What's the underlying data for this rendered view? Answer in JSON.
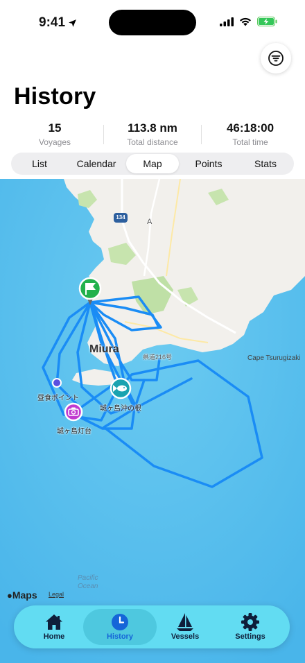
{
  "status_bar": {
    "time": "9:41"
  },
  "header": {
    "title": "History",
    "filter_icon": "filter-icon"
  },
  "stats": [
    {
      "value": "15",
      "label": "Voyages"
    },
    {
      "value": "113.8 nm",
      "label": "Total distance"
    },
    {
      "value": "46:18:00",
      "label": "Total time"
    }
  ],
  "segments": {
    "items": [
      "List",
      "Calendar",
      "Map",
      "Points",
      "Stats"
    ],
    "selected": "Map"
  },
  "map": {
    "place_labels": {
      "town": "Miura",
      "cape": "Cape Tsurugizaki",
      "road": "県道216号",
      "route_shield": "134",
      "letter": "A",
      "ocean_line1": "Pacific",
      "ocean_line2": "Ocean"
    },
    "markers": [
      {
        "label": "昼食ポイント",
        "icon": "dot-icon"
      },
      {
        "label": "城ヶ島沖の根",
        "icon": "fish-icon"
      },
      {
        "label": "城ヶ島灯台",
        "icon": "camera-icon"
      }
    ],
    "start_marker_icon": "flag-icon",
    "brand": "Maps",
    "legal": "Legal",
    "route_color": "#1a8cf5",
    "water_color": "#5cc0ee",
    "land_color": "#f2f0ec"
  },
  "tabbar": {
    "tabs": [
      {
        "label": "Home",
        "icon": "home-icon"
      },
      {
        "label": "History",
        "icon": "clock-icon"
      },
      {
        "label": "Vessels",
        "icon": "sailboat-icon"
      },
      {
        "label": "Settings",
        "icon": "gear-icon"
      }
    ],
    "active": "History",
    "bar_color": "#62dcf2",
    "active_color": "#1565d8"
  }
}
